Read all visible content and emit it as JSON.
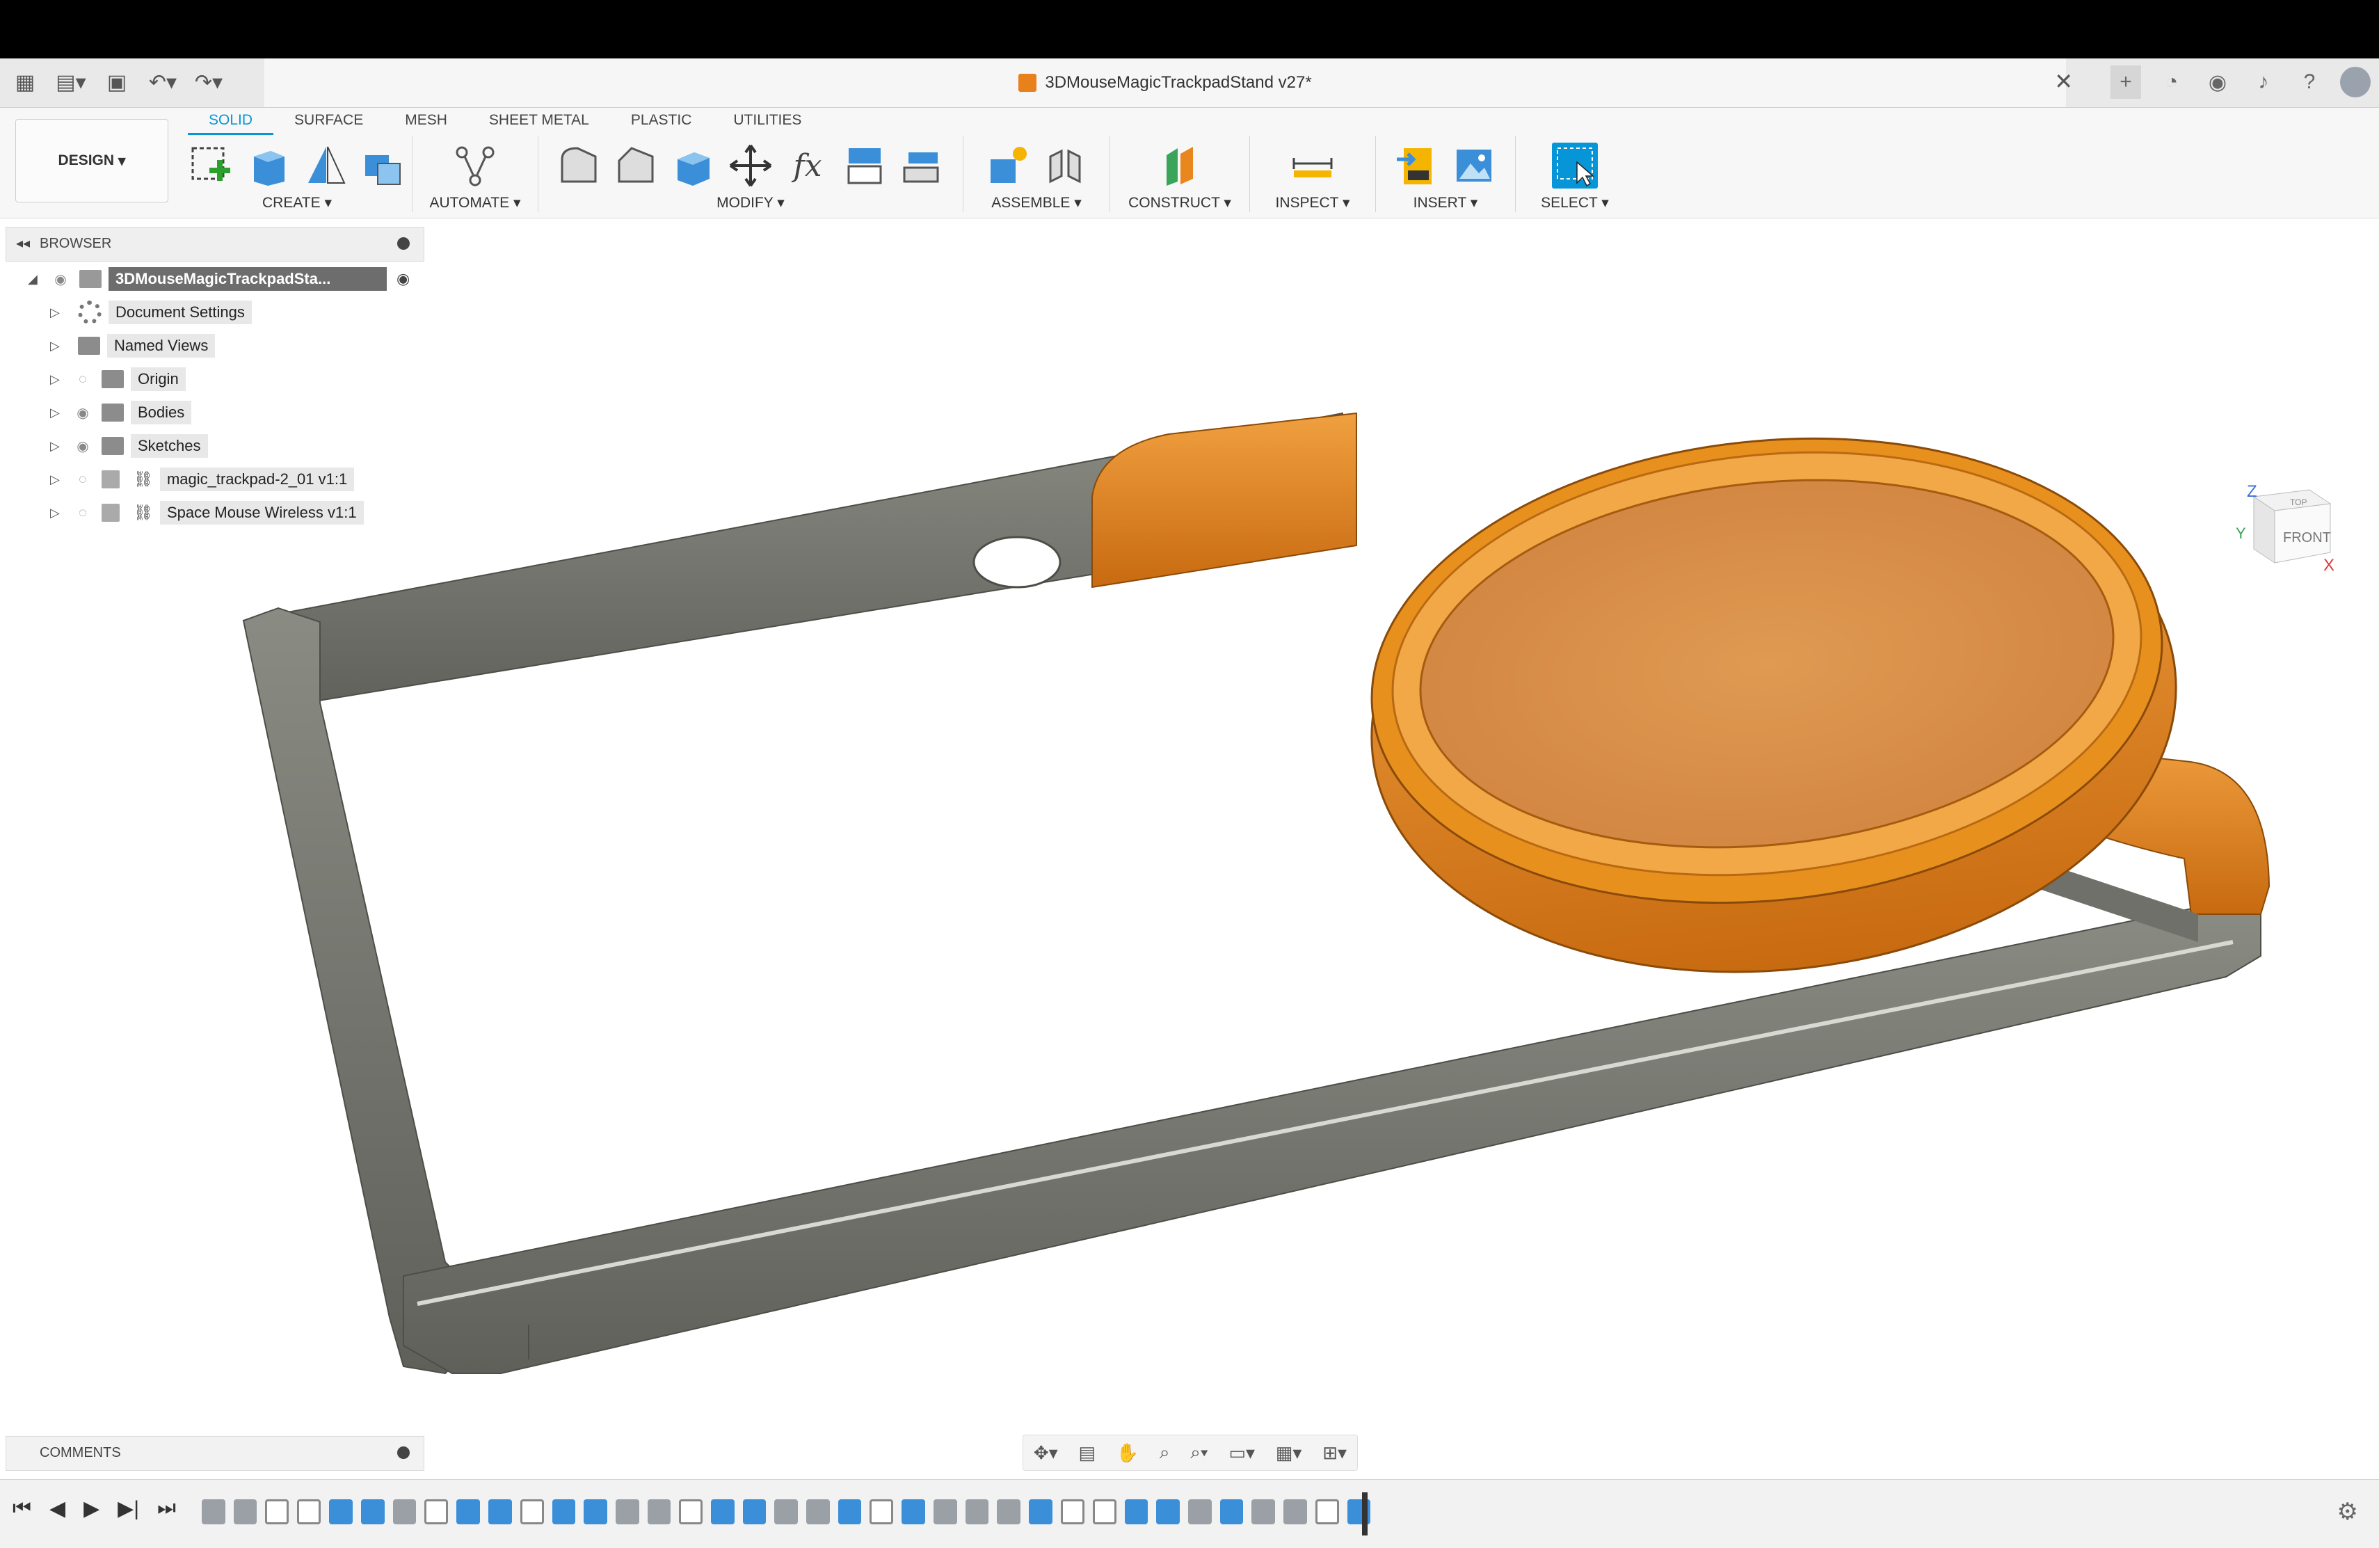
{
  "window": {
    "title": "3DMouseMagicTrackpadStand v27*"
  },
  "toolbar": {
    "design_label": "DESIGN",
    "tabs": [
      {
        "label": "SOLID",
        "active": true
      },
      {
        "label": "SURFACE",
        "active": false
      },
      {
        "label": "MESH",
        "active": false
      },
      {
        "label": "SHEET METAL",
        "active": false
      },
      {
        "label": "PLASTIC",
        "active": false
      },
      {
        "label": "UTILITIES",
        "active": false
      }
    ],
    "groups": [
      {
        "label": "CREATE",
        "icons": [
          "create-sketch-icon",
          "extrude-icon",
          "revolve-icon",
          "box-icon"
        ]
      },
      {
        "label": "AUTOMATE",
        "icons": [
          "automate-icon"
        ]
      },
      {
        "label": "MODIFY",
        "icons": [
          "fillet-icon",
          "chamfer-icon",
          "shell-icon",
          "move-icon",
          "parameters-icon",
          "press-pull-icon",
          "combine-icon"
        ]
      },
      {
        "label": "ASSEMBLE",
        "icons": [
          "new-component-icon",
          "joint-icon"
        ]
      },
      {
        "label": "CONSTRUCT",
        "icons": [
          "offset-plane-icon"
        ]
      },
      {
        "label": "INSPECT",
        "icons": [
          "measure-icon"
        ]
      },
      {
        "label": "INSERT",
        "icons": [
          "insert-svg-icon",
          "insert-image-icon"
        ]
      },
      {
        "label": "SELECT",
        "icons": [
          "select-icon"
        ]
      }
    ]
  },
  "browser": {
    "header": "BROWSER",
    "root": "3DMouseMagicTrackpadSta...",
    "items": [
      {
        "label": "Document Settings"
      },
      {
        "label": "Named Views"
      },
      {
        "label": "Origin"
      },
      {
        "label": "Bodies"
      },
      {
        "label": "Sketches"
      },
      {
        "label": "magic_trackpad-2_01 v1:1"
      },
      {
        "label": "Space Mouse Wireless v1:1"
      }
    ]
  },
  "comments": {
    "header": "COMMENTS"
  },
  "viewcube": {
    "front": "FRONT",
    "top": "TOP",
    "axis_z": "Z",
    "axis_x": "X",
    "axis_y": "Y"
  },
  "colors": {
    "accent": "#0696d7",
    "orange_body": "#e8871e",
    "gray_body": "#7b7c74"
  }
}
